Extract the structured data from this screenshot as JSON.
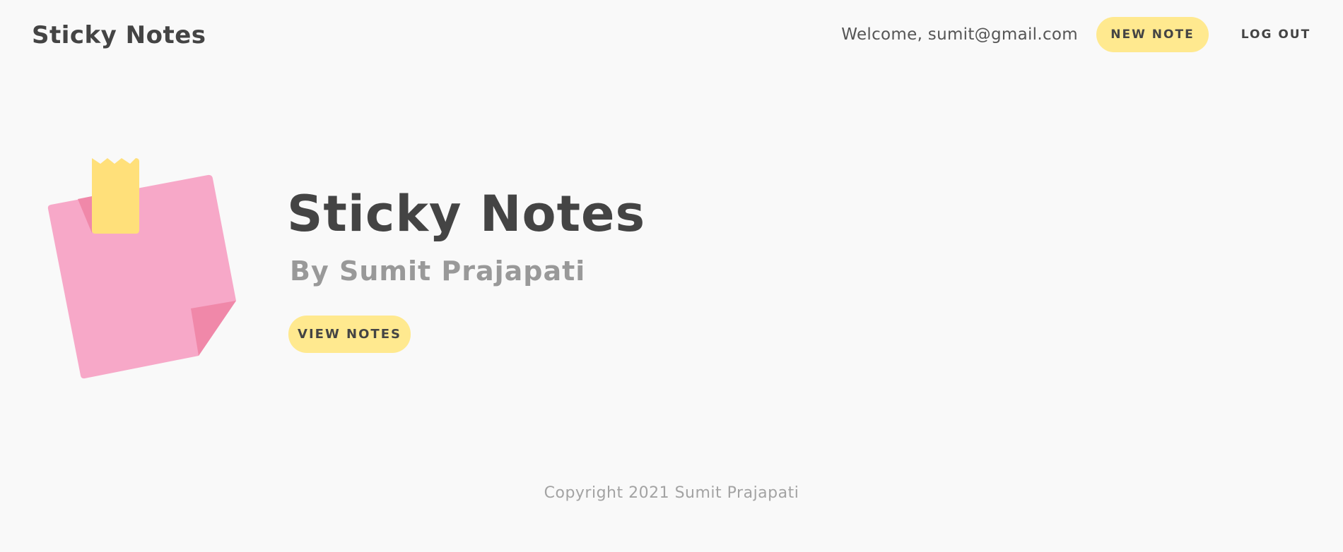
{
  "header": {
    "brand": "Sticky Notes",
    "welcome_text": "Welcome, sumit@gmail.com",
    "new_note_label": "NEW NOTE",
    "logout_label": "LOG OUT"
  },
  "hero": {
    "illustration": "sticky-note-icon",
    "title": "Sticky Notes",
    "subtitle": "By Sumit Prajapati",
    "view_notes_label": "VIEW NOTES"
  },
  "footer": {
    "copyright": "Copyright 2021 Sumit Prajapati"
  },
  "colors": {
    "background": "#f9f9f9",
    "accent_yellow": "#ffe98f",
    "note_pink": "#f7a8c8",
    "note_pink_dark": "#f088a9",
    "tape_yellow": "#ffe07a",
    "text_dark": "#444444",
    "text_muted": "#999999"
  }
}
